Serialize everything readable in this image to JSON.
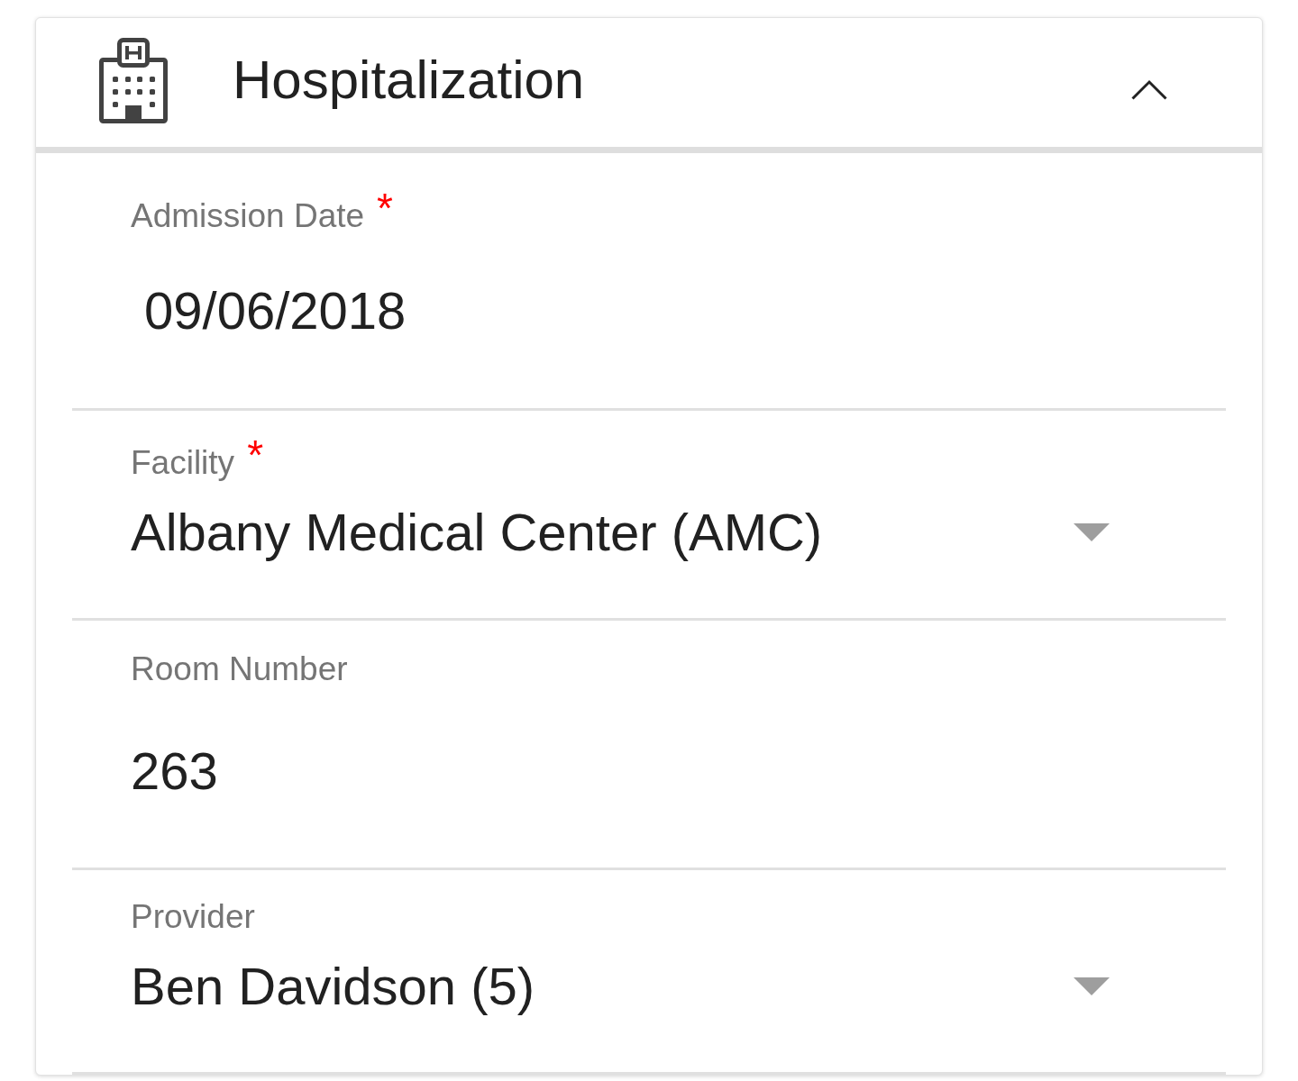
{
  "card": {
    "title": "Hospitalization",
    "expanded": true
  },
  "fields": [
    {
      "kind": "date",
      "label": "Admission Date",
      "required_mark": "*",
      "value": "09/06/2018"
    },
    {
      "kind": "select",
      "label": "Facility",
      "required_mark": "*",
      "value": "Albany Medical Center (AMC)"
    },
    {
      "kind": "text",
      "label": "Room Number",
      "value": "263"
    },
    {
      "kind": "select",
      "label": "Provider",
      "value": "Ben Davidson (5)"
    }
  ]
}
